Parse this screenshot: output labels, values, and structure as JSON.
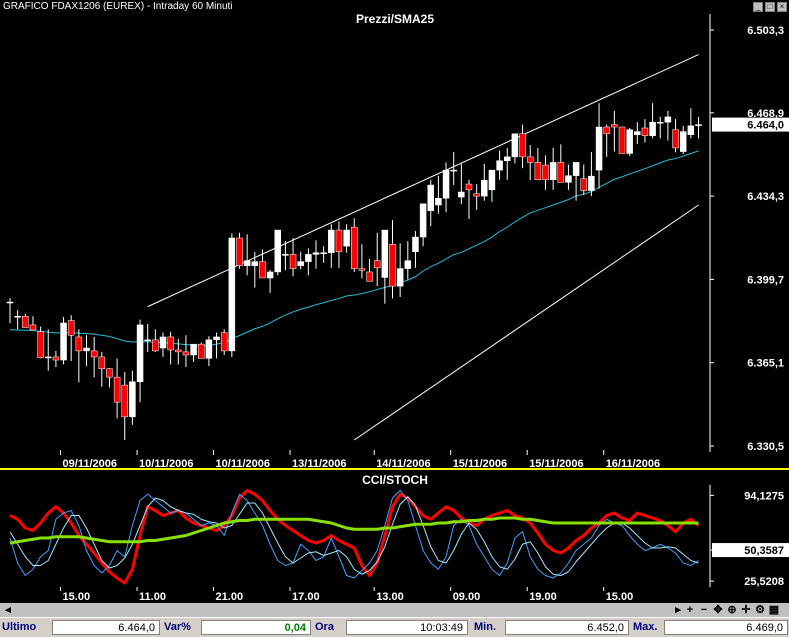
{
  "window": {
    "title": "GRAFICO FDAX1206 (EUREX) - Intraday 60 Minuti"
  },
  "colors": {
    "background": "#000000",
    "bull": "#ffffff",
    "bear": "#ff0000",
    "sma": "#1fbfd8",
    "channel": "#ffffff",
    "cci": "#ff0000",
    "stoch_k": "#3fa0ff",
    "stoch_d": "#9fe8ff",
    "stoch_avg": "#88e000",
    "separator": "#ffff00"
  },
  "chart_data": [
    {
      "type": "candlestick",
      "title": "Prezzi/SMA25",
      "y_ticks": [
        "6.503,3",
        "6.468,9",
        "6.434,3",
        "6.399,7",
        "6.365,1",
        "6.330,5"
      ],
      "y_tick_values": [
        6503.3,
        6468.9,
        6434.3,
        6399.7,
        6365.1,
        6330.5
      ],
      "ylim": [
        6330.5,
        6503.3
      ],
      "last_price_label": "6.464,0",
      "last_price": 6464.0,
      "x_labels": [
        "09/11/2006",
        "10/11/2006",
        "10/11/2006",
        "13/11/2006",
        "14/11/2006",
        "15/11/2006",
        "15/11/2006",
        "16/11/2006"
      ],
      "x_label_index": [
        7,
        17,
        27,
        37,
        48,
        58,
        68,
        78
      ],
      "candles": [
        [
          6390.3,
          6392.0,
          6381.6,
          6390.3
        ],
        [
          6384.4,
          6386.9,
          6379.0,
          6384.4
        ],
        [
          6384.4,
          6385.4,
          6379.7,
          6379.7
        ],
        [
          6380.8,
          6384.4,
          6378.7,
          6378.7
        ],
        [
          6378.0,
          6380.1,
          6366.9,
          6367.2
        ],
        [
          6367.2,
          6379.0,
          6361.8,
          6367.5
        ],
        [
          6367.5,
          6370.0,
          6363.3,
          6366.2
        ],
        [
          6366.2,
          6384.1,
          6364.4,
          6381.6
        ],
        [
          6382.6,
          6384.8,
          6365.8,
          6376.5
        ],
        [
          6375.8,
          6379.0,
          6356.9,
          6370.0
        ],
        [
          6370.0,
          6376.5,
          6363.7,
          6371.2
        ],
        [
          6370.0,
          6375.8,
          6359.1,
          6367.5
        ],
        [
          6367.5,
          6369.6,
          6355.1,
          6362.6
        ],
        [
          6362.6,
          6362.9,
          6354.8,
          6359.1
        ],
        [
          6359.1,
          6366.9,
          6342.0,
          6348.7
        ],
        [
          6355.8,
          6361.2,
          6333.0,
          6342.6
        ],
        [
          6342.6,
          6361.8,
          6339.3,
          6357.2
        ],
        [
          6357.2,
          6383.0,
          6348.7,
          6380.8
        ],
        [
          6374.6,
          6381.2,
          6369.6,
          6374.6
        ],
        [
          6374.6,
          6379.0,
          6369.6,
          6370.0
        ],
        [
          6371.2,
          6377.6,
          6367.5,
          6375.8
        ],
        [
          6375.8,
          6378.0,
          6364.4,
          6370.4
        ],
        [
          6370.4,
          6375.1,
          6364.4,
          6369.6
        ],
        [
          6369.6,
          6376.5,
          6363.3,
          6368.3
        ],
        [
          6368.3,
          6372.8,
          6365.4,
          6372.8
        ],
        [
          6372.8,
          6373.5,
          6366.9,
          6366.9
        ],
        [
          6366.9,
          6376.1,
          6363.7,
          6374.6
        ],
        [
          6374.6,
          6377.6,
          6366.9,
          6375.8
        ],
        [
          6377.6,
          6379.0,
          6368.3,
          6370.0
        ],
        [
          6370.0,
          6418.8,
          6367.5,
          6416.9
        ],
        [
          6416.9,
          6419.1,
          6404.2,
          6405.4
        ],
        [
          6405.4,
          6418.4,
          6401.4,
          6407.5
        ],
        [
          6405.4,
          6411.2,
          6396.3,
          6407.1
        ],
        [
          6407.1,
          6412.2,
          6401.0,
          6400.3
        ],
        [
          6400.3,
          6403.6,
          6394.1,
          6402.8
        ],
        [
          6402.8,
          6417.3,
          6401.4,
          6420.2
        ],
        [
          6409.8,
          6415.6,
          6403.5,
          6410.1
        ],
        [
          6410.1,
          6416.9,
          6401.0,
          6404.2
        ],
        [
          6405.4,
          6411.2,
          6403.9,
          6407.1
        ],
        [
          6407.1,
          6412.6,
          6401.4,
          6410.1
        ],
        [
          6410.1,
          6415.9,
          6404.2,
          6410.8
        ],
        [
          6410.8,
          6413.5,
          6406.6,
          6410.8
        ],
        [
          6410.8,
          6422.6,
          6404.5,
          6420.2
        ],
        [
          6420.2,
          6423.8,
          6404.5,
          6411.2
        ],
        [
          6413.5,
          6422.6,
          6410.8,
          6420.2
        ],
        [
          6421.4,
          6425.1,
          6402.8,
          6404.2
        ],
        [
          6404.2,
          6414.3,
          6400.1,
          6403.5
        ],
        [
          6402.8,
          6408.2,
          6398.9,
          6398.9
        ],
        [
          6407.5,
          6419.1,
          6396.9,
          6404.5
        ],
        [
          6400.5,
          6419.9,
          6389.6,
          6420.2
        ],
        [
          6414.3,
          6424.3,
          6391.8,
          6396.9
        ],
        [
          6396.9,
          6414.7,
          6392.4,
          6404.2
        ],
        [
          6404.2,
          6415.6,
          6399.7,
          6407.5
        ],
        [
          6411.2,
          6419.8,
          6404.5,
          6417.3
        ],
        [
          6417.3,
          6426.7,
          6413.5,
          6431.1
        ],
        [
          6428.2,
          6441.1,
          6421.8,
          6438.9
        ],
        [
          6430.6,
          6442.8,
          6427.0,
          6433.4
        ],
        [
          6433.4,
          6448.3,
          6427.6,
          6445.1
        ],
        [
          6445.1,
          6452.6,
          6438.9,
          6445.1
        ],
        [
          6433.9,
          6447.7,
          6431.0,
          6436.0
        ],
        [
          6439.3,
          6441.1,
          6424.8,
          6436.9
        ],
        [
          6435.3,
          6439.3,
          6428.6,
          6434.3
        ],
        [
          6434.3,
          6447.7,
          6432.4,
          6440.9
        ],
        [
          6436.9,
          6445.1,
          6431.9,
          6445.1
        ],
        [
          6445.1,
          6453.2,
          6441.1,
          6449.0
        ],
        [
          6449.0,
          6454.3,
          6441.1,
          6450.6
        ],
        [
          6450.6,
          6460.2,
          6447.9,
          6460.2
        ],
        [
          6460.2,
          6464.0,
          6445.9,
          6450.6
        ],
        [
          6450.6,
          6455.5,
          6440.9,
          6448.3
        ],
        [
          6448.3,
          6454.3,
          6442.8,
          6441.1
        ],
        [
          6447.2,
          6451.2,
          6436.9,
          6441.1
        ],
        [
          6441.1,
          6454.4,
          6436.9,
          6448.3
        ],
        [
          6448.3,
          6455.8,
          6440.2,
          6440.0
        ],
        [
          6440.0,
          6447.4,
          6436.9,
          6442.8
        ],
        [
          6442.8,
          6448.0,
          6432.4,
          6448.3
        ],
        [
          6441.5,
          6447.4,
          6434.8,
          6436.6
        ],
        [
          6436.6,
          6452.6,
          6434.3,
          6442.6
        ],
        [
          6445.1,
          6472.9,
          6437.4,
          6463.0
        ],
        [
          6463.0,
          6464.0,
          6450.6,
          6460.2
        ],
        [
          6464.0,
          6469.7,
          6452.8,
          6463.0
        ],
        [
          6463.0,
          6463.0,
          6454.3,
          6452.0
        ],
        [
          6452.0,
          6462.6,
          6451.0,
          6461.9
        ],
        [
          6459.8,
          6465.0,
          6455.9,
          6461.1
        ],
        [
          6462.6,
          6466.3,
          6456.5,
          6459.4
        ],
        [
          6459.4,
          6472.9,
          6458.3,
          6465.0
        ],
        [
          6465.0,
          6467.2,
          6458.3,
          6465.0
        ],
        [
          6465.0,
          6469.7,
          6457.4,
          6467.2
        ],
        [
          6461.9,
          6466.3,
          6452.5,
          6454.3
        ],
        [
          6452.8,
          6463.5,
          6451.8,
          6461.1
        ],
        [
          6459.8,
          6470.8,
          6458.3,
          6463.5
        ],
        [
          6463.5,
          6467.2,
          6458.3,
          6464.0
        ]
      ],
      "sma25": [
        6378.8,
        6378.7,
        6378.6,
        6378.5,
        6378.1,
        6377.8,
        6377.5,
        6377.6,
        6377.6,
        6377.4,
        6377.2,
        6376.9,
        6376.5,
        6376.0,
        6375.1,
        6374.1,
        6373.7,
        6373.9,
        6373.8,
        6373.6,
        6373.5,
        6373.2,
        6372.9,
        6372.6,
        6372.5,
        6372.0,
        6372.3,
        6372.8,
        6373.4,
        6375.1,
        6376.4,
        6377.8,
        6379.2,
        6380.2,
        6381.6,
        6383.4,
        6384.9,
        6386.2,
        6387.3,
        6388.2,
        6389.2,
        6390.0,
        6391.0,
        6391.8,
        6392.8,
        6393.2,
        6393.8,
        6394.6,
        6395.5,
        6396.4,
        6397.2,
        6398.3,
        6399.4,
        6400.8,
        6403.2,
        6405.0,
        6406.4,
        6408.2,
        6410.0,
        6410.9,
        6412.4,
        6413.9,
        6415.4,
        6417.3,
        6419.6,
        6421.4,
        6423.6,
        6425.5,
        6427.3,
        6428.4,
        6429.5,
        6430.6,
        6431.7,
        6432.9,
        6434.4,
        6435.1,
        6436.2,
        6437.9,
        6439.6,
        6441.3,
        6442.3,
        6443.5,
        6444.6,
        6445.7,
        6446.9,
        6448.1,
        6449.3,
        6449.9,
        6450.9,
        6452.0,
        6453.1
      ],
      "channel_upper": {
        "x": [
          18,
          90
        ],
        "y": [
          6388.4,
          6493.1
        ]
      },
      "channel_lower": {
        "x": [
          45,
          90
        ],
        "y": [
          6333.0,
          6430.6
        ]
      }
    },
    {
      "type": "line",
      "title": "CCI/STOCH",
      "y_ticks": [
        "94,1275",
        "50,3587",
        "25,5208"
      ],
      "y_tick_values": [
        94.1275,
        50.3587,
        25.5208
      ],
      "ylim": [
        20,
        100
      ],
      "x_labels": [
        "15.00",
        "11.00",
        "21.00",
        "17.00",
        "13.00",
        "09.00",
        "19.00",
        "15.00"
      ],
      "x_label_index": [
        7,
        17,
        27,
        37,
        48,
        58,
        68,
        78
      ],
      "series": [
        {
          "key": "cci",
          "color": "#ff0000",
          "values": [
            78,
            75,
            68,
            66,
            72,
            80,
            85,
            80,
            72,
            62,
            55,
            48,
            40,
            33,
            28,
            24,
            35,
            62,
            85,
            82,
            78,
            80,
            82,
            76,
            72,
            70,
            68,
            66,
            70,
            78,
            92,
            98,
            95,
            90,
            82,
            75,
            70,
            66,
            62,
            58,
            56,
            58,
            62,
            58,
            55,
            52,
            38,
            30,
            40,
            62,
            85,
            95,
            92,
            85,
            78,
            75,
            80,
            85,
            82,
            76,
            72,
            70,
            75,
            78,
            80,
            82,
            78,
            76,
            72,
            64,
            55,
            50,
            48,
            52,
            58,
            62,
            68,
            72,
            78,
            80,
            76,
            74,
            80,
            78,
            76,
            74,
            70,
            65,
            72,
            75,
            70
          ]
        },
        {
          "key": "stoch_k",
          "color": "#3fa0ff",
          "values": [
            60,
            40,
            30,
            35,
            45,
            50,
            75,
            80,
            82,
            70,
            50,
            38,
            32,
            38,
            50,
            45,
            70,
            90,
            95,
            90,
            85,
            80,
            82,
            80,
            75,
            70,
            72,
            70,
            62,
            80,
            95,
            90,
            80,
            70,
            55,
            42,
            38,
            40,
            55,
            50,
            42,
            45,
            60,
            45,
            30,
            28,
            34,
            40,
            50,
            70,
            92,
            98,
            90,
            70,
            50,
            40,
            35,
            45,
            70,
            75,
            70,
            55,
            45,
            35,
            30,
            40,
            60,
            65,
            45,
            35,
            30,
            28,
            32,
            40,
            50,
            55,
            60,
            70,
            75,
            72,
            70,
            62,
            55,
            50,
            52,
            55,
            52,
            48,
            40,
            38,
            42
          ]
        },
        {
          "key": "stoch_d",
          "color": "#9fe8ff",
          "values": [
            65,
            55,
            45,
            38,
            38,
            42,
            55,
            68,
            78,
            78,
            68,
            55,
            42,
            36,
            38,
            44,
            55,
            70,
            85,
            92,
            90,
            85,
            82,
            80,
            79,
            75,
            73,
            72,
            68,
            70,
            79,
            88,
            88,
            80,
            68,
            56,
            45,
            40,
            44,
            48,
            49,
            46,
            48,
            50,
            45,
            35,
            31,
            34,
            41,
            53,
            71,
            87,
            93,
            86,
            70,
            53,
            42,
            40,
            50,
            63,
            72,
            67,
            57,
            45,
            37,
            35,
            43,
            55,
            57,
            48,
            37,
            31,
            30,
            33,
            41,
            48,
            55,
            62,
            68,
            72,
            72,
            68,
            62,
            56,
            52,
            52,
            53,
            52,
            47,
            42,
            40
          ]
        },
        {
          "key": "stoch_avg",
          "color": "#88e000",
          "values": [
            56,
            57,
            58,
            59,
            60,
            60,
            61,
            61,
            61,
            61,
            60,
            59,
            58,
            57,
            57,
            57,
            57,
            57,
            58,
            58,
            59,
            60,
            61,
            62,
            64,
            66,
            68,
            70,
            72,
            73,
            74,
            74,
            75,
            75,
            75,
            75,
            75,
            75,
            75,
            75,
            74,
            73,
            72,
            70,
            68,
            67,
            67,
            67,
            67,
            68,
            68,
            69,
            70,
            71,
            71,
            71,
            72,
            72,
            73,
            73,
            74,
            74,
            75,
            75,
            76,
            76,
            76,
            75,
            75,
            74,
            73,
            72,
            72,
            72,
            72,
            72,
            72,
            72,
            72,
            72,
            72,
            72,
            72,
            72,
            72,
            72,
            72,
            72,
            72,
            72,
            72
          ]
        }
      ]
    }
  ],
  "toolbar": {
    "tools": [
      {
        "name": "zoom-in-icon",
        "glyph": "+"
      },
      {
        "name": "zoom-out-icon",
        "glyph": "−"
      },
      {
        "name": "move-icon",
        "glyph": "✥"
      },
      {
        "name": "crosshair-icon",
        "glyph": "⊕"
      },
      {
        "name": "pan-icon",
        "glyph": "✛"
      },
      {
        "name": "settings-icon",
        "glyph": "⚙"
      },
      {
        "name": "grid-icon",
        "glyph": "▦"
      }
    ]
  },
  "status": {
    "ultimo_label": "Ultimo",
    "ultimo_value": "6.464,0",
    "var_label": "Var%",
    "var_value": "0,04",
    "ora_label": "Ora",
    "ora_value": "10:03:49",
    "min_label": "Min.",
    "min_value": "6.452,0",
    "max_label": "Max.",
    "max_value": "6.469,0"
  }
}
